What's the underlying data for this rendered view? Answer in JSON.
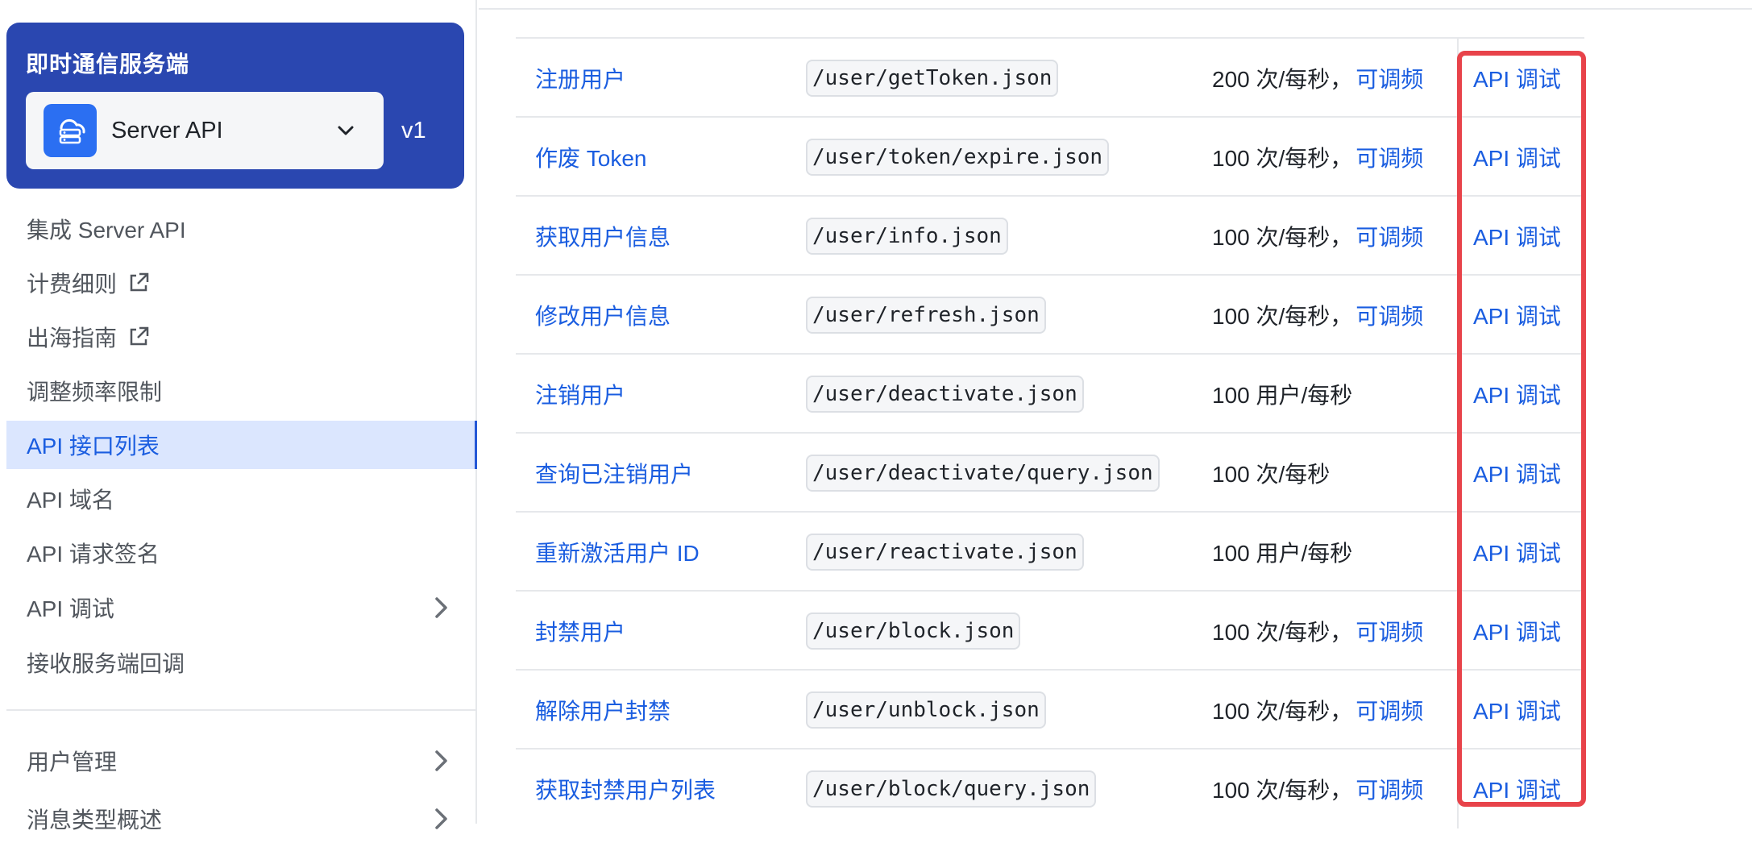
{
  "sidebar": {
    "product_title": "即时通信服务端",
    "product_select": {
      "value": "Server API",
      "icon": "server-cloud-icon"
    },
    "version": "v1",
    "items": [
      {
        "label": "集成 Server API",
        "external": false,
        "expandable": false,
        "active": false
      },
      {
        "label": "计费细则",
        "external": true,
        "expandable": false,
        "active": false
      },
      {
        "label": "出海指南",
        "external": true,
        "expandable": false,
        "active": false
      },
      {
        "label": "调整频率限制",
        "external": false,
        "expandable": false,
        "active": false
      },
      {
        "label": "API 接口列表",
        "external": false,
        "expandable": false,
        "active": true
      },
      {
        "label": "API 域名",
        "external": false,
        "expandable": false,
        "active": false
      },
      {
        "label": "API 请求签名",
        "external": false,
        "expandable": false,
        "active": false
      },
      {
        "label": "API 调试",
        "external": false,
        "expandable": true,
        "active": false
      },
      {
        "label": "接收服务端回调",
        "external": false,
        "expandable": false,
        "active": false
      },
      {
        "label": "用户管理",
        "external": false,
        "expandable": true,
        "active": false
      },
      {
        "label": "消息类型概述",
        "external": false,
        "expandable": true,
        "active": false
      }
    ]
  },
  "colors": {
    "brand": "#2a47b0",
    "link": "#1a5de0",
    "highlight": "#e8434a",
    "active_bg": "#dbe6fe"
  },
  "api_table": {
    "rows": [
      {
        "name": "注册用户",
        "path": "/user/getToken.json",
        "rate": "200 次/每秒，",
        "rate_link": "可调频",
        "debug": "API 调试"
      },
      {
        "name": "作废 Token",
        "path": "/user/token/expire.json",
        "rate": "100 次/每秒，",
        "rate_link": "可调频",
        "debug": "API 调试"
      },
      {
        "name": "获取用户信息",
        "path": "/user/info.json",
        "rate": "100 次/每秒，",
        "rate_link": "可调频",
        "debug": "API 调试"
      },
      {
        "name": "修改用户信息",
        "path": "/user/refresh.json",
        "rate": "100 次/每秒，",
        "rate_link": "可调频",
        "debug": "API 调试"
      },
      {
        "name": "注销用户",
        "path": "/user/deactivate.json",
        "rate": "100 用户/每秒",
        "rate_link": "",
        "debug": "API 调试"
      },
      {
        "name": "查询已注销用户",
        "path": "/user/deactivate/query.json",
        "rate": "100 次/每秒",
        "rate_link": "",
        "debug": "API 调试"
      },
      {
        "name": "重新激活用户 ID",
        "path": "/user/reactivate.json",
        "rate": "100 用户/每秒",
        "rate_link": "",
        "debug": "API 调试"
      },
      {
        "name": "封禁用户",
        "path": "/user/block.json",
        "rate": "100 次/每秒，",
        "rate_link": "可调频",
        "debug": "API 调试"
      },
      {
        "name": "解除用户封禁",
        "path": "/user/unblock.json",
        "rate": "100 次/每秒，",
        "rate_link": "可调频",
        "debug": "API 调试"
      },
      {
        "name": "获取封禁用户列表",
        "path": "/user/block/query.json",
        "rate": "100 次/每秒，",
        "rate_link": "可调频",
        "debug": "API 调试"
      }
    ]
  }
}
